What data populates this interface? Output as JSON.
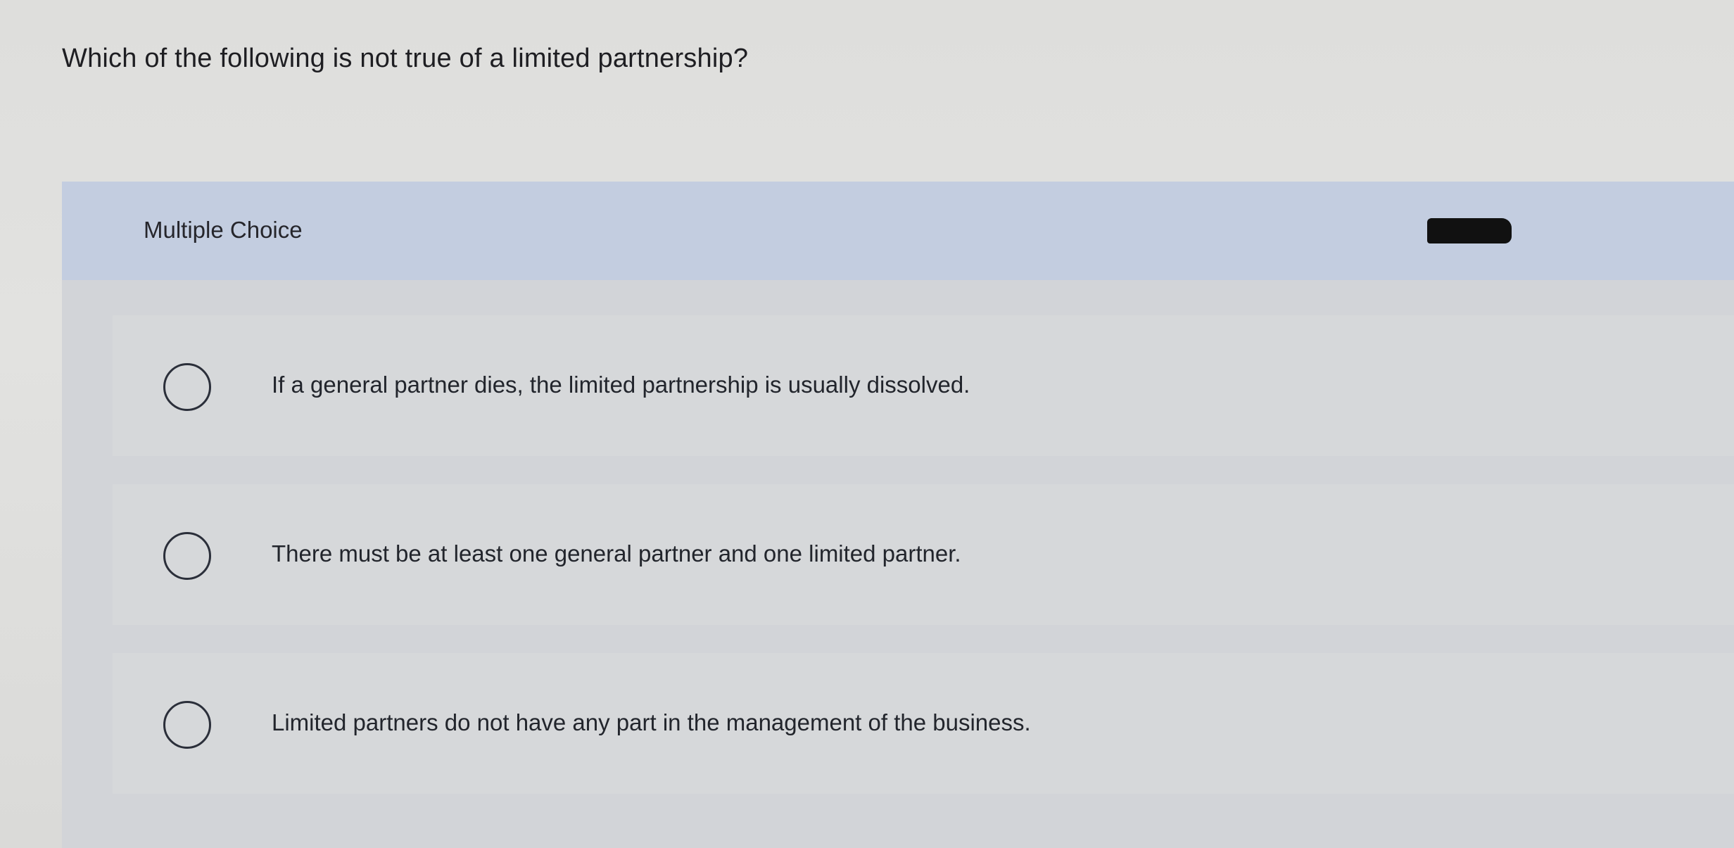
{
  "question": {
    "text": "Which of the following is not true of a limited partnership?"
  },
  "panel": {
    "label": "Multiple Choice"
  },
  "options": [
    {
      "text": "If a general partner dies, the limited partnership is usually dissolved."
    },
    {
      "text": "There must be at least one general partner and one limited partner."
    },
    {
      "text": "Limited partners do not have any part in the management of the business."
    }
  ],
  "colors": {
    "header_band": "#c3cde0",
    "option_bg": "#d6d8da",
    "text": "#22252c"
  }
}
